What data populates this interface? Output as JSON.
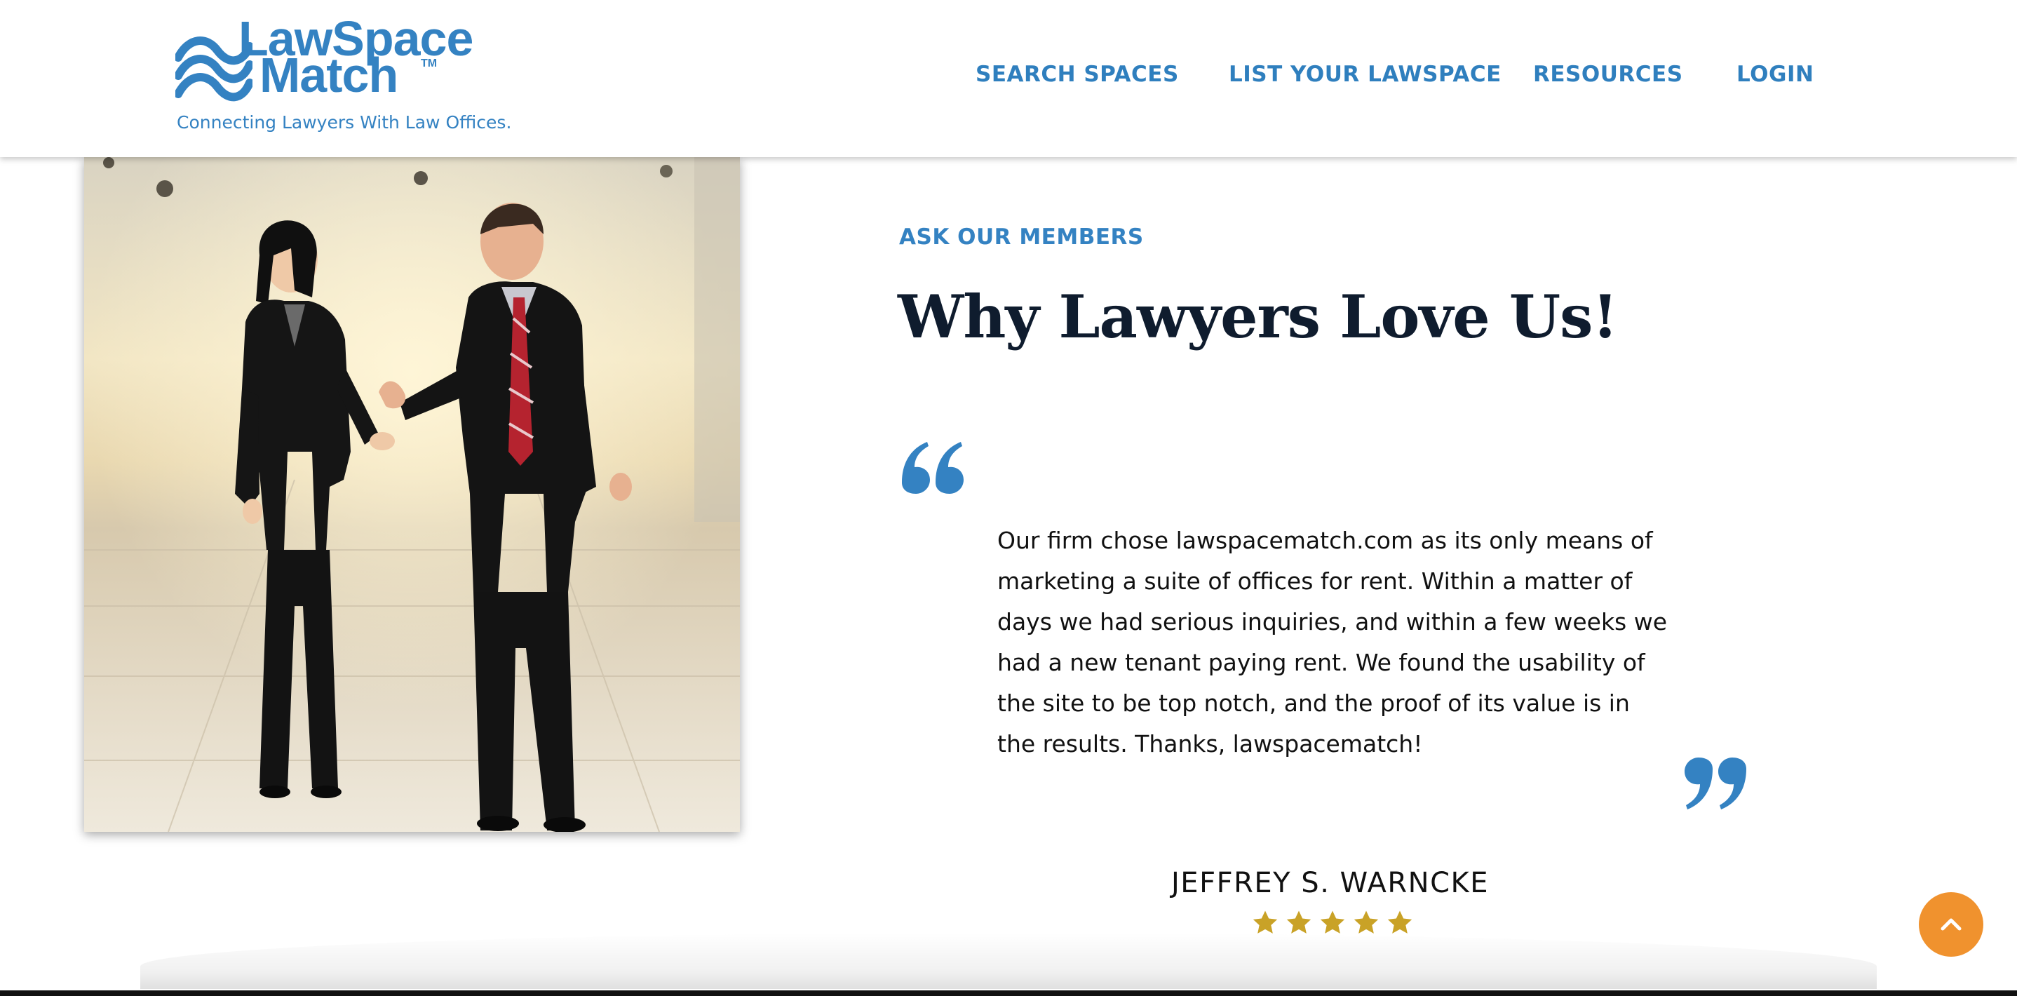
{
  "brand": {
    "logo_line1": "LawSpace",
    "logo_line2": "Match",
    "logo_tm": "TM",
    "tagline": "Connecting Lawyers With Law Offices.",
    "color": "#3482c2"
  },
  "nav": {
    "items": [
      {
        "label": "SEARCH SPACES"
      },
      {
        "label": "LIST YOUR LAWSPACE"
      },
      {
        "label": "RESOURCES"
      },
      {
        "label": "LOGIN"
      }
    ]
  },
  "testimonial": {
    "eyebrow": "ASK OUR MEMBERS",
    "headline": "Why Lawyers Love Us!",
    "quote": "Our firm chose lawspacematch.com as its only means of marketing a suite of offices for rent. Within a matter of days we had serious inquiries, and within a few weeks we had a new tenant paying rent. We found the usability of the site to be top notch, and the proof of its value is in the results. Thanks, lawspacematch!",
    "author": "JEFFREY S. WARNCKE",
    "rating": 5,
    "star_color": "#c9a227",
    "quote_mark_color": "#3482c2"
  },
  "photo": {
    "icon": "people-walking-photo"
  },
  "controls": {
    "back_to_top_icon": "chevron-up-icon",
    "back_to_top_color": "#f0922e"
  }
}
